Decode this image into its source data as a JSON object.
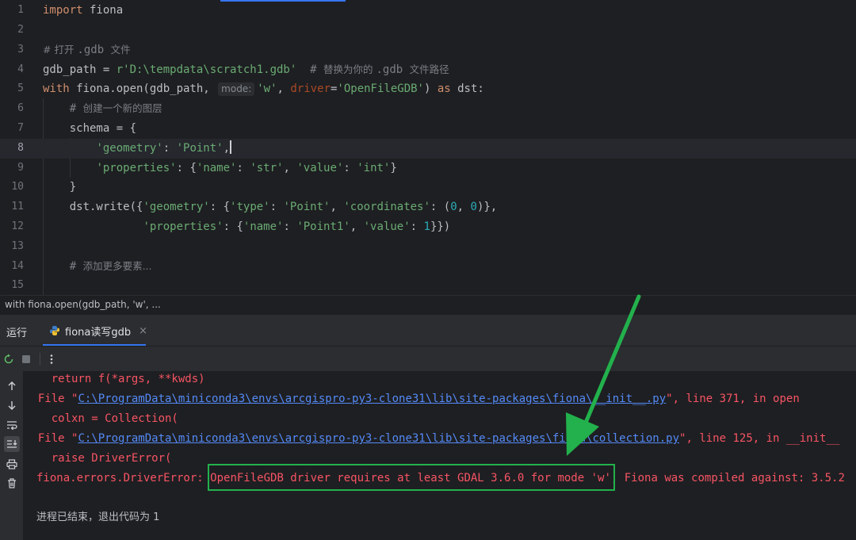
{
  "editor": {
    "lines": [
      {
        "n": "1"
      },
      {
        "n": "2"
      },
      {
        "n": "3"
      },
      {
        "n": "4"
      },
      {
        "n": "5"
      },
      {
        "n": "6"
      },
      {
        "n": "7"
      },
      {
        "n": "8"
      },
      {
        "n": "9"
      },
      {
        "n": "10"
      },
      {
        "n": "11"
      },
      {
        "n": "12"
      },
      {
        "n": "13"
      },
      {
        "n": "14"
      },
      {
        "n": "15"
      }
    ],
    "l1": {
      "kw": "import",
      "rest": " fiona"
    },
    "l3": {
      "c1": "# 打开 ",
      "c2": ".gdb ",
      "c3": "文件"
    },
    "l4": {
      "a": "gdb_path = ",
      "b": "r'D:\\tempdata\\scratch1.gdb'",
      "c": "  # ",
      "d": "替换为你的 ",
      "e": ".gdb ",
      "f": "文件路径"
    },
    "l5": {
      "kw1": "with",
      "a": " fiona.open(gdb_path, ",
      "hint": "mode:",
      "s1": "'w'",
      "b": ", ",
      "p": "driver",
      "c": "=",
      "s2": "'OpenFileGDB'",
      "d": ") ",
      "kw2": "as",
      "e": " dst:"
    },
    "l6": {
      "c1": "    # ",
      "c2": "创建一个新的图层"
    },
    "l7": {
      "a": "    schema = {"
    },
    "l8": {
      "a": "        ",
      "s1": "'geometry'",
      "b": ": ",
      "s2": "'Point'",
      "c": ","
    },
    "l9": {
      "a": "        ",
      "s1": "'properties'",
      "b": ": {",
      "s2": "'name'",
      "c": ": ",
      "s3": "'str'",
      "d": ", ",
      "s4": "'value'",
      "e": ": ",
      "s5": "'int'",
      "f": "}"
    },
    "l10": {
      "a": "    }"
    },
    "l11": {
      "a": "    dst.write({",
      "s1": "'geometry'",
      "b": ": {",
      "s2": "'type'",
      "c": ": ",
      "s3": "'Point'",
      "d": ", ",
      "s4": "'coordinates'",
      "e": ": (",
      "n1": "0",
      "f": ", ",
      "n2": "0",
      "g": ")},"
    },
    "l12": {
      "a": "               ",
      "s1": "'properties'",
      "b": ": {",
      "s2": "'name'",
      "c": ": ",
      "s3": "'Point1'",
      "d": ", ",
      "s4": "'value'",
      "e": ": ",
      "n1": "1",
      "f": "}})"
    },
    "l14": {
      "c1": "    # ",
      "c2": "添加更多要素..."
    }
  },
  "breadcrumb": "with fiona.open(gdb_path, 'w', ...",
  "run_panel": {
    "title": "运行",
    "tab_label": "fiona读写gdb",
    "tab_close": "×"
  },
  "console": {
    "c1": "    return f(*args, **kwds)",
    "c2a": "  File \"",
    "c2link": "C:\\ProgramData\\miniconda3\\envs\\arcgispro-py3-clone31\\lib\\site-packages\\fiona\\__init__.py",
    "c2b": "\", line 371, in open",
    "c3": "    colxn = Collection(",
    "c4a": "  File \"",
    "c4link": "C:\\ProgramData\\miniconda3\\envs\\arcgispro-py3-clone31\\lib\\site-packages\\fiona\\collection.py",
    "c4b": "\", line 125, in __init__",
    "c5": "    raise DriverError(",
    "c6a": "fiona.errors.DriverError: ",
    "c6b": "OpenFileGDB driver requires at least GDAL 3.6.0 for mode 'w',",
    "c6c": " Fiona was compiled against: 3.5.2",
    "c7": "进程已结束，退出代码为 1"
  },
  "colors": {
    "annotation_box": "#22b14c",
    "annotation_arrow": "#22b14c",
    "error_text": "#f75464",
    "link": "#548af7"
  },
  "icons": [
    "rerun-icon",
    "stop-icon",
    "more-icon",
    "up-arrow-icon",
    "down-arrow-icon",
    "soft-wrap-icon",
    "scroll-to-end-icon",
    "print-icon",
    "trash-icon",
    "python-file-icon"
  ]
}
